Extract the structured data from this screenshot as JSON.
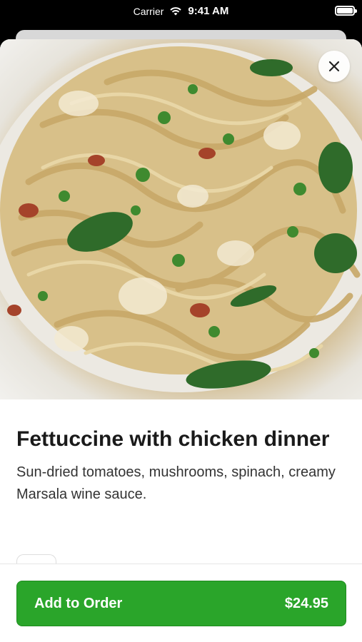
{
  "status_bar": {
    "carrier": "Carrier",
    "time": "9:41 AM"
  },
  "icons": {
    "wifi": "wifi-icon",
    "battery": "battery-icon",
    "close": "close-icon"
  },
  "item": {
    "title": "Fettuccine with chicken dinner",
    "description": "Sun-dried tomatoes, mushrooms, spinach, creamy Marsala wine sauce."
  },
  "footer": {
    "add_label": "Add to Order",
    "price": "$24.95"
  },
  "colors": {
    "accent": "#2aa52a"
  }
}
